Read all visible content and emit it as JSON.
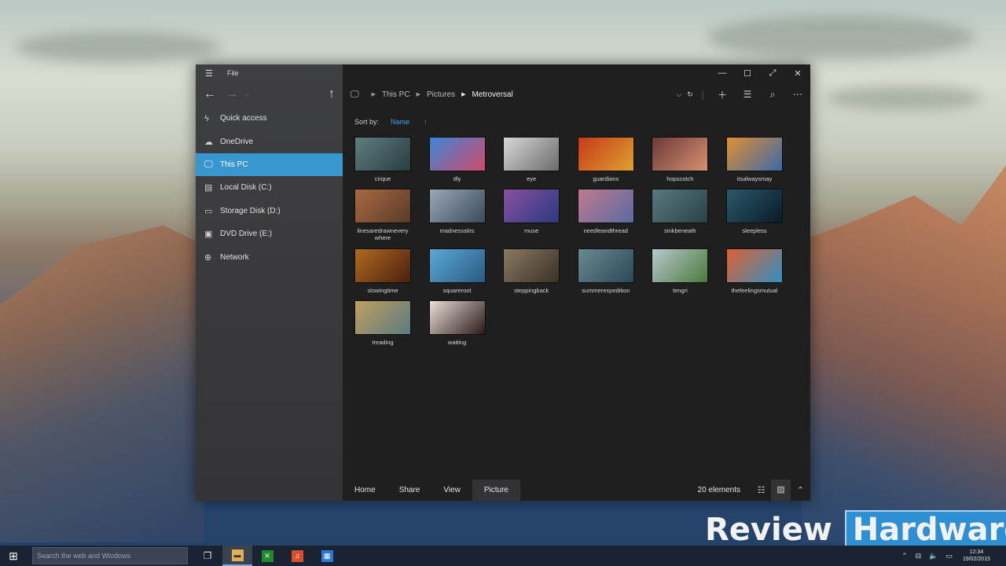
{
  "window": {
    "menu_label": "File",
    "controls": {
      "minimize": "—",
      "maximize": "☐",
      "fullscreen": "⤢",
      "close": "✕"
    }
  },
  "navigation": {
    "back": "←",
    "forward": "→",
    "dropdown": "⌵",
    "up": "↑"
  },
  "sidebar": {
    "items": [
      {
        "label": "Quick access",
        "icon": "lightning-icon",
        "glyph": "ϟ",
        "active": false
      },
      {
        "label": "OneDrive",
        "icon": "cloud-icon",
        "glyph": "☁",
        "active": false
      },
      {
        "label": "This PC",
        "icon": "monitor-icon",
        "glyph": "🖵",
        "active": true
      },
      {
        "label": "Local Disk (C:)",
        "icon": "disk-icon",
        "glyph": "▤",
        "active": false
      },
      {
        "label": "Storage Disk (D:)",
        "icon": "disk-icon",
        "glyph": "▭",
        "active": false
      },
      {
        "label": "DVD Drive (E:)",
        "icon": "dvd-icon",
        "glyph": "▣",
        "active": false
      },
      {
        "label": "Network",
        "icon": "network-icon",
        "glyph": "⊕",
        "active": false
      }
    ]
  },
  "address": {
    "crumbs": [
      "This PC",
      "Pictures",
      "Metroversal"
    ]
  },
  "sort": {
    "label": "Sort by:",
    "value": "Name",
    "direction": "↑"
  },
  "files": [
    {
      "name": "cirque",
      "c1": "#5f7e80",
      "c2": "#2a3c40"
    },
    {
      "name": "dly",
      "c1": "#3b86d6",
      "c2": "#d24a6a"
    },
    {
      "name": "eye",
      "c1": "#d8d8d8",
      "c2": "#6a6a6a"
    },
    {
      "name": "guardians",
      "c1": "#c43a1a",
      "c2": "#e0a030"
    },
    {
      "name": "hopscotch",
      "c1": "#6a3a3a",
      "c2": "#d89070"
    },
    {
      "name": "itsalwaysmay",
      "c1": "#e09030",
      "c2": "#3a6aa8"
    },
    {
      "name": "linesaredrawneverywhere",
      "label": "linesaredrawnevery where",
      "c1": "#a86a40",
      "c2": "#5a3a2a"
    },
    {
      "name": "madnessstirs",
      "c1": "#9aa8b8",
      "c2": "#3a4a5a"
    },
    {
      "name": "muse",
      "c1": "#8a50a0",
      "c2": "#2a3a80"
    },
    {
      "name": "needleandthread",
      "c1": "#c07a90",
      "c2": "#5a6aa0"
    },
    {
      "name": "sinkbeneath",
      "c1": "#5a7a80",
      "c2": "#2a4048"
    },
    {
      "name": "sleepless",
      "c1": "#2a5a6a",
      "c2": "#0a1a28"
    },
    {
      "name": "slowingtime",
      "c1": "#b06a20",
      "c2": "#4a2010"
    },
    {
      "name": "squareroot",
      "c1": "#5aa8d8",
      "c2": "#2a5a80"
    },
    {
      "name": "steppingback",
      "c1": "#8a7a60",
      "c2": "#3a3028"
    },
    {
      "name": "summerexpedition",
      "c1": "#6a8a90",
      "c2": "#2a4858"
    },
    {
      "name": "tengri",
      "c1": "#b8c8d0",
      "c2": "#4a7a3a"
    },
    {
      "name": "thefeelingsmutual",
      "c1": "#e06030",
      "c2": "#3090c0"
    },
    {
      "name": "treading",
      "c1": "#c0a060",
      "c2": "#5a7a80"
    },
    {
      "name": "waiting",
      "c1": "#e8e0d8",
      "c2": "#2a1818"
    }
  ],
  "ribbon": {
    "tabs": [
      {
        "label": "Home",
        "active": false
      },
      {
        "label": "Share",
        "active": false
      },
      {
        "label": "View",
        "active": false
      },
      {
        "label": "Picture",
        "active": true
      }
    ],
    "status": "20 elements"
  },
  "taskbar": {
    "search_placeholder": "Search the web and Windows",
    "clock_time": "12:34",
    "clock_date": "19/02/2015"
  },
  "watermark": {
    "part1": "Review",
    "part2": "Hardware"
  }
}
